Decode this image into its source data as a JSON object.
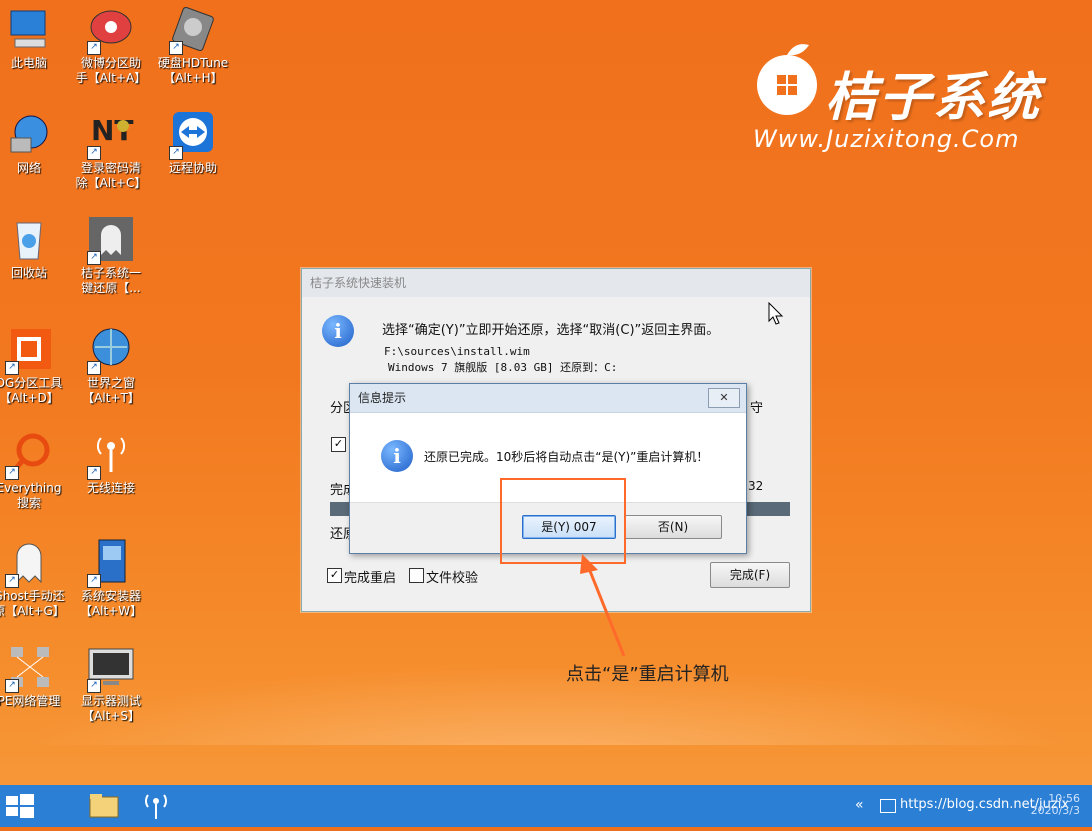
{
  "desktop": {
    "icons": [
      {
        "label": "此电脑",
        "icon": "computer-icon"
      },
      {
        "label": "微博分区助\n手【Alt+A】",
        "icon": "partition-icon"
      },
      {
        "label": "硬盘HDTune\n【Alt+H】",
        "icon": "harddisk-icon"
      },
      {
        "label": "网络",
        "icon": "network-globe-icon"
      },
      {
        "label": "登录密码清\n除【Alt+C】",
        "icon": "password-key-icon"
      },
      {
        "label": "远程协助",
        "icon": "teamviewer-icon"
      },
      {
        "label": "回收站",
        "icon": "recycle-bin-icon"
      },
      {
        "label": "桔子系统一\n键还原【...",
        "icon": "ghost-restore-icon"
      },
      {
        "label": "DG分区工具\n【Alt+D】",
        "icon": "diskgenius-icon"
      },
      {
        "label": "世界之窗\n【Alt+T】",
        "icon": "browser-globe-icon"
      },
      {
        "label": "Everything\n搜索",
        "icon": "everything-search-icon"
      },
      {
        "label": "无线连接",
        "icon": "wireless-icon"
      },
      {
        "label": "Ghost手动还\n原【Alt+G】",
        "icon": "ghost-icon"
      },
      {
        "label": "系统安装器\n【Alt+W】",
        "icon": "installer-icon"
      },
      {
        "label": "PE网络管理",
        "icon": "network-manager-icon"
      },
      {
        "label": "显示器测试\n【Alt+S】",
        "icon": "monitor-test-icon"
      }
    ]
  },
  "logo": {
    "title": "桔子系统",
    "url": "Www.Juzixitong.Com"
  },
  "main_window": {
    "title": "桔子系统快速装机",
    "prompt": "选择“确定(Y)”立即开始还原，选择“取消(C)”返回主界面。",
    "file_path": "F:\\sources\\install.wim",
    "image_info": "Windows 7 旗舰版 [8.03 GB]  还原到：C:",
    "partition_label": "分区",
    "right_label": "守",
    "done_label": "完成",
    "number_32": "32",
    "restore_label": "还原",
    "chk_restart": "完成重启",
    "chk_verify": "文件校验",
    "finish_button": "完成(F)",
    "progress": 1.0
  },
  "dialog": {
    "title": "信息提示",
    "close": "✕",
    "message": "还原已完成。10秒后将自动点击“是(Y)”重启计算机！",
    "yes_button": "是(Y) 007",
    "no_button": "否(N)"
  },
  "annotation": "点击“是”重启计算机",
  "taskbar": {
    "tray_text": "https://blog.csdn.net/juzix",
    "time": "10:56",
    "date": "2020/3/3"
  },
  "colors": {
    "desktop_orange": "#f0701c",
    "taskbar_blue": "#2b7fd4",
    "highlight": "#ff6a2a",
    "info_blue": "#1f5fc8"
  }
}
